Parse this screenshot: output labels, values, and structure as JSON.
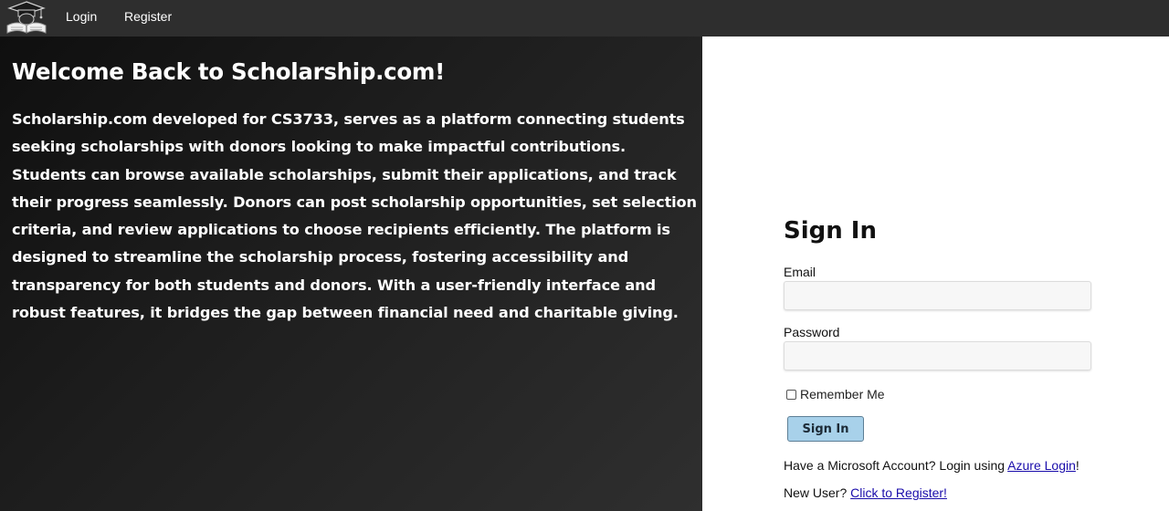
{
  "nav": {
    "logo_icon": "graduation-cap-book-icon",
    "login_label": "Login",
    "register_label": "Register"
  },
  "hero": {
    "title": "Welcome Back to Scholarship.com!",
    "description": "Scholarship.com developed for CS3733, serves as a platform connecting students seeking scholarships with donors looking to make impactful contributions. Students can browse available scholarships, submit their applications, and track their progress seamlessly. Donors can post scholarship opportunities, set selection criteria, and review applications to choose recipients efficiently. The platform is designed to streamline the scholarship process, fostering accessibility and transparency for both students and donors. With a user-friendly interface and robust features, it bridges the gap between financial need and charitable giving."
  },
  "signin": {
    "title": "Sign In",
    "email_label": "Email",
    "email_value": "",
    "password_label": "Password",
    "password_value": "",
    "remember_label": "Remember Me",
    "remember_checked": false,
    "button_label": "Sign In",
    "azure_prefix": "Have a Microsoft Account? Login using ",
    "azure_link": "Azure Login",
    "azure_suffix": "!",
    "register_prefix": "New User? ",
    "register_link": "Click to Register!"
  },
  "colors": {
    "navbar_bg": "#2e2e2e",
    "hero_bg_dark": "#0f0f0f",
    "button_bg": "#a8d1ea",
    "link": "#1a0dab"
  }
}
